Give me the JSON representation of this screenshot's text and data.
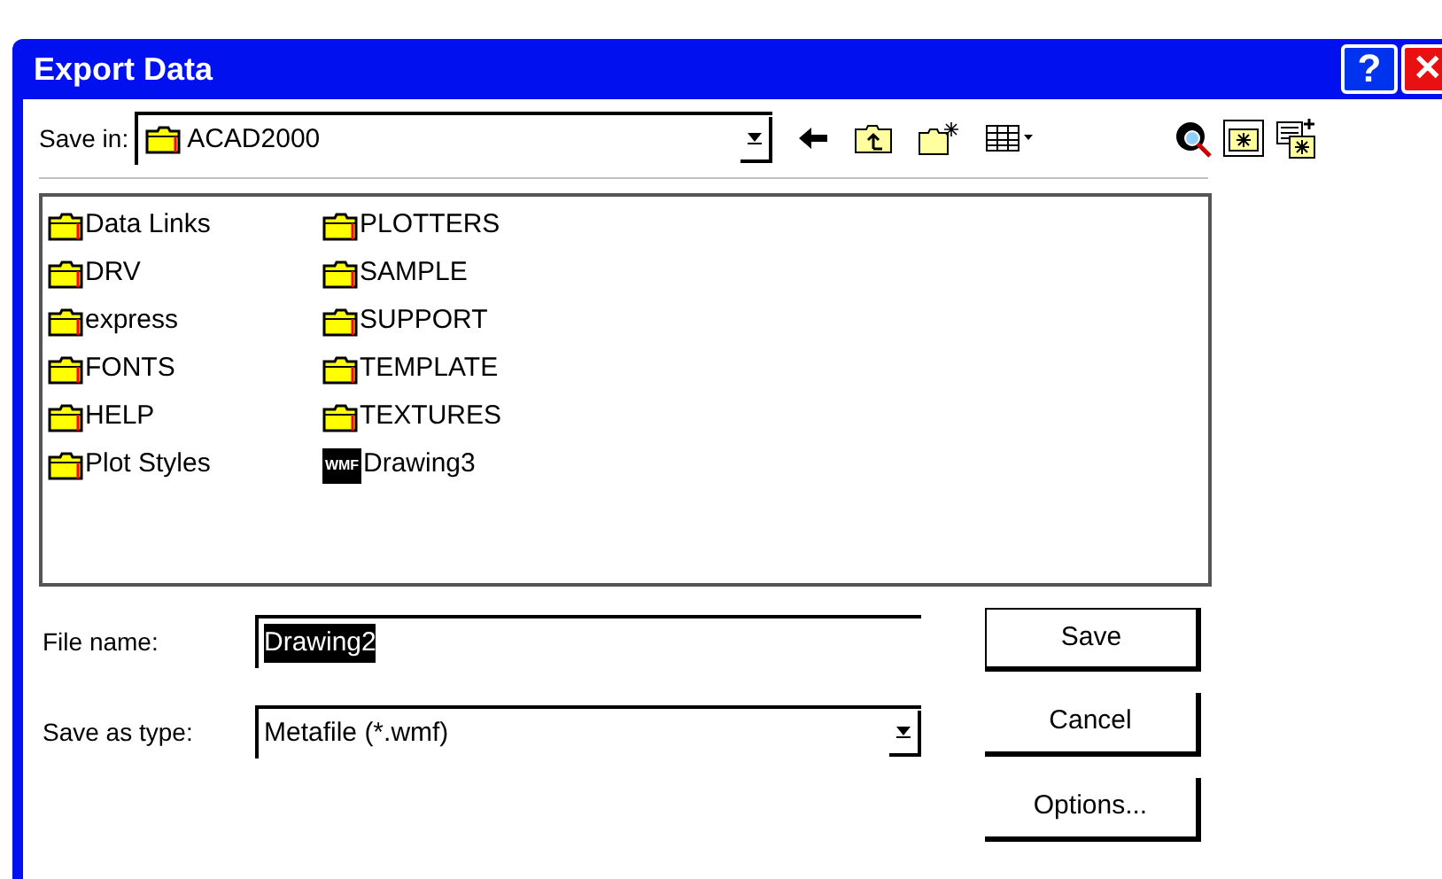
{
  "window": {
    "title": "Export Data",
    "title_buttons": [
      {
        "kind": "help",
        "label": "?"
      },
      {
        "kind": "close",
        "label": "✕"
      }
    ]
  },
  "toolbar": {
    "save_in_label": "Save in:",
    "save_in_value": "ACAD2000",
    "buttons": [
      {
        "kind": "back"
      },
      {
        "kind": "up"
      },
      {
        "kind": "new-folder"
      },
      {
        "kind": "views"
      }
    ],
    "extra_buttons": [
      {
        "kind": "find"
      },
      {
        "kind": "folder-star"
      },
      {
        "kind": "add"
      }
    ]
  },
  "files": [
    {
      "name": "Data Links",
      "kind": "folder"
    },
    {
      "name": "DRV",
      "kind": "folder"
    },
    {
      "name": "express",
      "kind": "folder"
    },
    {
      "name": "FONTS",
      "kind": "folder"
    },
    {
      "name": "HELP",
      "kind": "folder"
    },
    {
      "name": "Plot Styles",
      "kind": "folder"
    },
    {
      "name": "PLOTTERS",
      "kind": "folder"
    },
    {
      "name": "SAMPLE",
      "kind": "folder"
    },
    {
      "name": "SUPPORT",
      "kind": "folder"
    },
    {
      "name": "TEMPLATE",
      "kind": "folder"
    },
    {
      "name": "TEXTURES",
      "kind": "folder"
    },
    {
      "name": "Drawing3",
      "kind": "wmf",
      "badge": "WMF"
    }
  ],
  "file_name": {
    "label": "File name:",
    "value": "Drawing2",
    "selected": true
  },
  "save_as_type": {
    "label": "Save as type:",
    "value": "Metafile (*.wmf)"
  },
  "buttons": [
    {
      "label": "Save",
      "default": true
    },
    {
      "label": "Cancel",
      "default": false
    },
    {
      "label": "Options...",
      "default": false
    }
  ]
}
